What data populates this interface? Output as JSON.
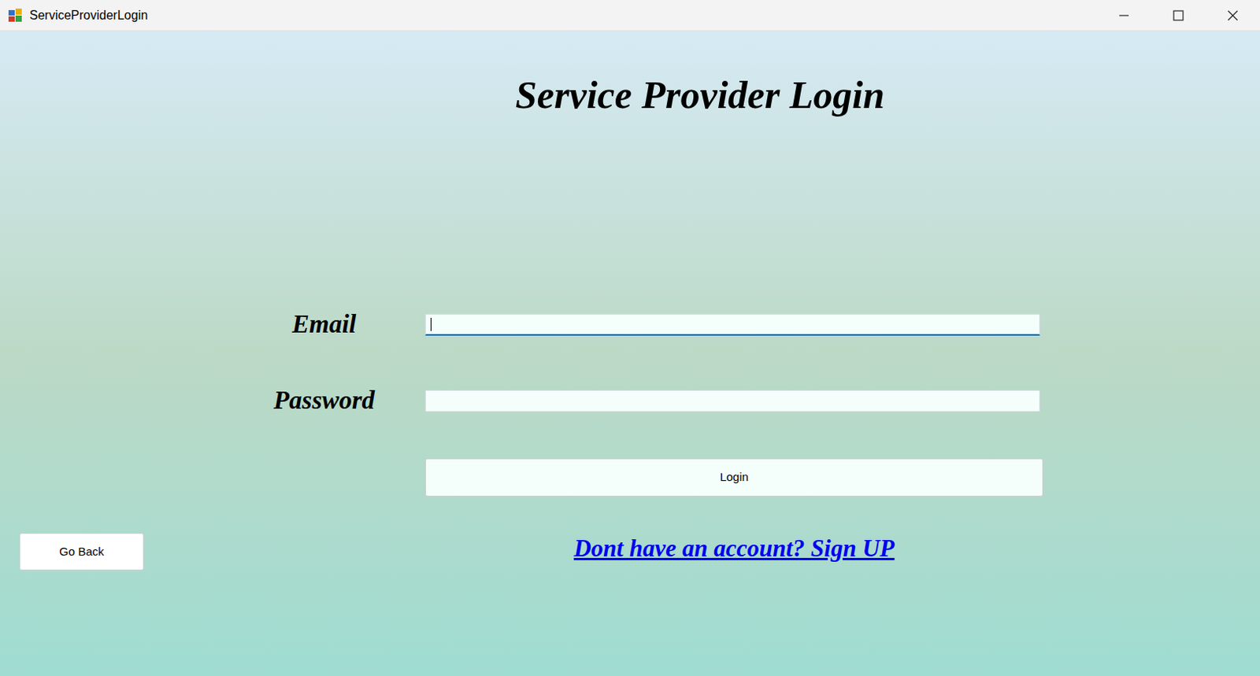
{
  "window": {
    "title": "ServiceProviderLogin"
  },
  "heading": "Service Provider Login",
  "fields": [
    {
      "label": "Email",
      "value": "",
      "focused": true
    },
    {
      "label": "Password",
      "value": "",
      "focused": false
    }
  ],
  "login_button": "Login",
  "signup_link": "Dont have an account? Sign UP",
  "back_button": "Go Back"
}
